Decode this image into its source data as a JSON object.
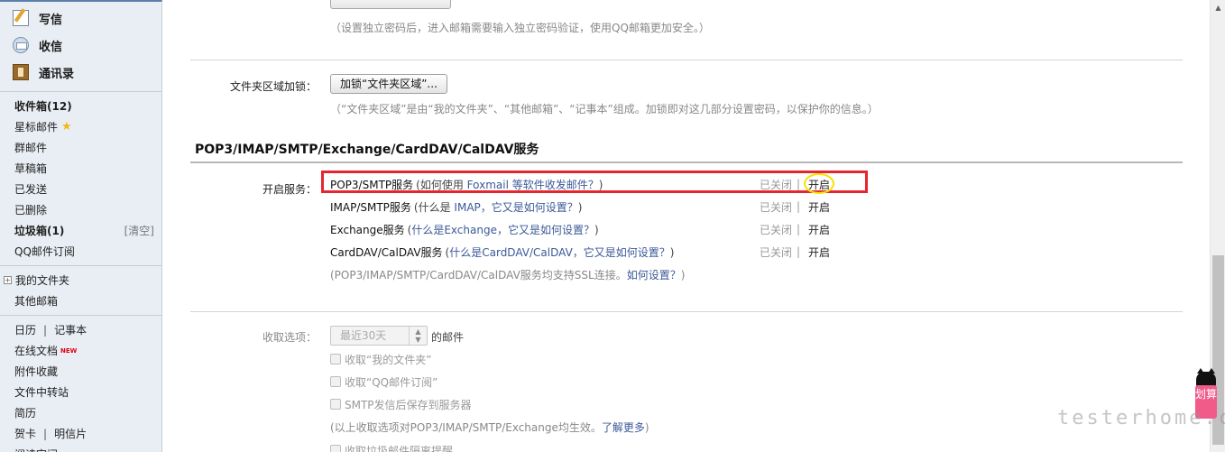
{
  "sidebar": {
    "actions": [
      "写信",
      "收信",
      "通讯录"
    ],
    "folders": {
      "inbox_label": "收件箱",
      "inbox_count": "(12)",
      "starred": "星标邮件",
      "group": "群邮件",
      "drafts": "草稿箱",
      "sent": "已发送",
      "deleted": "已删除",
      "spam_label": "垃圾箱",
      "spam_count": "(1)",
      "spam_clear": "[清空]",
      "subscriptions": "QQ邮件订阅"
    },
    "my_folders": "我的文件夹",
    "other_mailboxes": "其他邮箱",
    "tools": {
      "calendar": "日历",
      "notes": "记事本",
      "online_docs": "在线文档",
      "new_badge": "NEW",
      "attachments": "附件收藏",
      "transfer": "文件中转站",
      "resume": "简历",
      "cards": "贺卡",
      "postcards": "明信片",
      "reading": "阅读空间"
    }
  },
  "content": {
    "independent_pwd_hint": "（设置独立密码后，进入邮箱需要输入独立密码验证，使用QQ邮箱更加安全。）",
    "folder_lock": {
      "label": "文件夹区域加锁：",
      "button": "加锁“文件夹区域”...",
      "hint": "（“文件夹区域”是由“我的文件夹”、“其他邮箱”、“记事本”组成。加锁即对这几部分设置密码，以保护你的信息。）"
    },
    "section_title": "POP3/IMAP/SMTP/Exchange/CardDAV/CalDAV服务",
    "services_label": "开启服务：",
    "services": [
      {
        "name": "POP3/SMTP服务",
        "help_prefix": "(如何使用 ",
        "help_link": "Foxmail 等软件收发邮件？",
        "help_suffix": ")",
        "status": "已关闭",
        "toggle": "开启"
      },
      {
        "name": "IMAP/SMTP服务",
        "help_prefix": "(什么是 ",
        "help_link": "IMAP，它又是如何设置？",
        "help_suffix": ")",
        "status": "已关闭",
        "toggle": "开启"
      },
      {
        "name": "Exchange服务",
        "help_prefix": "(",
        "help_link": "什么是Exchange，它又是如何设置？",
        "help_suffix": ")",
        "status": "已关闭",
        "toggle": "开启"
      },
      {
        "name": "CardDAV/CalDAV服务",
        "help_prefix": "(",
        "help_link": "什么是CardDAV/CalDAV，它又是如何设置？",
        "help_suffix": ")",
        "status": "已关闭",
        "toggle": "开启"
      }
    ],
    "separator": "|",
    "ssl_hint_prefix": "(POP3/IMAP/SMTP/CardDAV/CalDAV服务均支持SSL连接。",
    "ssl_hint_link": "如何设置？",
    "ssl_hint_suffix": ")",
    "receive": {
      "label": "收取选项：",
      "select_value": "最近30天",
      "suffix": "的邮件",
      "options": [
        "收取“我的文件夹”",
        "收取“QQ邮件订阅”",
        "SMTP发信后保存到服务器"
      ],
      "hint_prefix": "(以上收取选项对POP3/IMAP/SMTP/Exchange均生效。",
      "hint_link": "了解更多",
      "hint_suffix": ")",
      "spam_option": "收取垃圾邮件隔离提醒"
    }
  },
  "widget": {
    "tag": "划算"
  },
  "watermark": "testerhome.com",
  "colors": {
    "highlight_box": "#e5262e",
    "highlight_circle": "#f5e400",
    "link": "#3b5998"
  }
}
